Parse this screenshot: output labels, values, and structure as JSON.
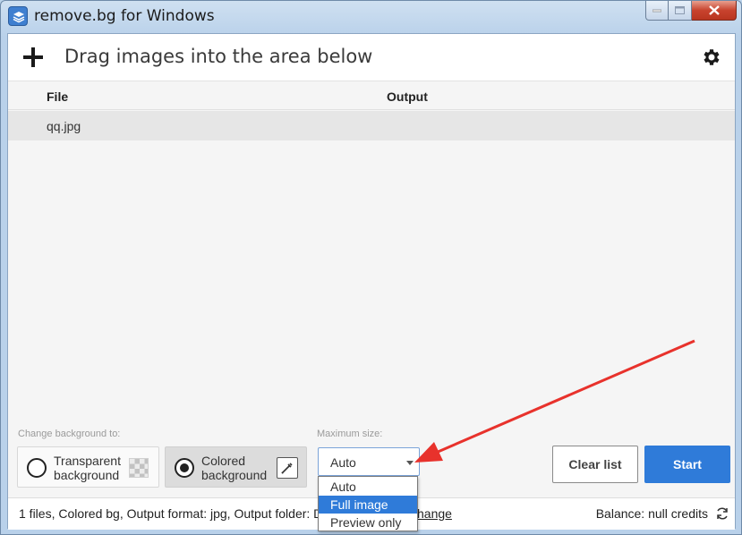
{
  "window": {
    "title": "remove.bg for Windows"
  },
  "header": {
    "title": "Drag images into the area below",
    "add_icon": "plus-icon",
    "settings_icon": "gear-icon"
  },
  "table": {
    "columns": [
      "File",
      "Output"
    ],
    "rows": [
      {
        "file": "qq.jpg",
        "output": ""
      }
    ]
  },
  "controls": {
    "change_bg_label": "Change background to:",
    "transparent_line1": "Transparent",
    "transparent_line2": "background",
    "colored_line1": "Colored",
    "colored_line2": "background",
    "selected_background": "colored",
    "max_size_label": "Maximum size:",
    "max_size_value": "Auto",
    "clear_label": "Clear list",
    "start_label": "Start"
  },
  "dropdown": {
    "options": [
      "Auto",
      "Full image",
      "Preview only"
    ],
    "highlighted": "Full image"
  },
  "status": {
    "text": "1 files, Colored bg, Output format: jpg, Output folder: D",
    "change_link": "hange",
    "balance": "Balance: null credits"
  },
  "colors": {
    "accent": "#2f7bd9",
    "annotation_arrow": "#e8322c"
  }
}
